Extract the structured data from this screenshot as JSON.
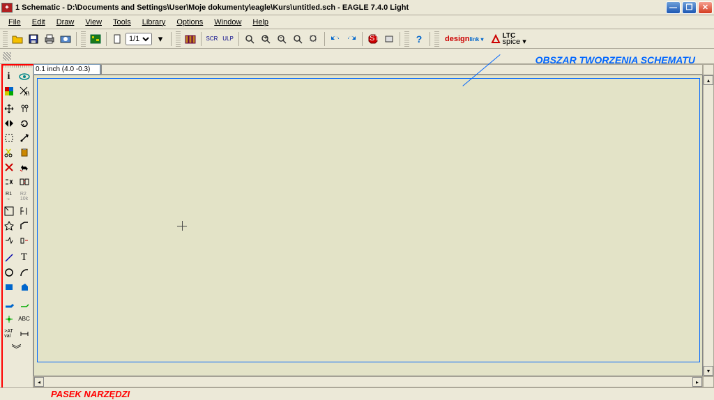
{
  "window": {
    "title": "1 Schematic - D:\\Documents and Settings\\User\\Moje dokumenty\\eagle\\Kurs\\untitled.sch - EAGLE 7.4.0 Light"
  },
  "menu": {
    "file": "File",
    "edit": "Edit",
    "draw": "Draw",
    "view": "View",
    "tools": "Tools",
    "library": "Library",
    "options": "Options",
    "window": "Window",
    "help": "Help"
  },
  "toolbar": {
    "grid_value": "1/1",
    "designlink": "design",
    "designlink_sub": "link ▾",
    "ltc": "LTC",
    "ltc_sub": "spice ▾"
  },
  "coords": "0.1 inch (4.0 -0.3)",
  "annotations": {
    "schema_area": "OBSZAR TWORZENIA SCHEMATU",
    "tool_bar": "PASEK NARZĘDZI"
  }
}
